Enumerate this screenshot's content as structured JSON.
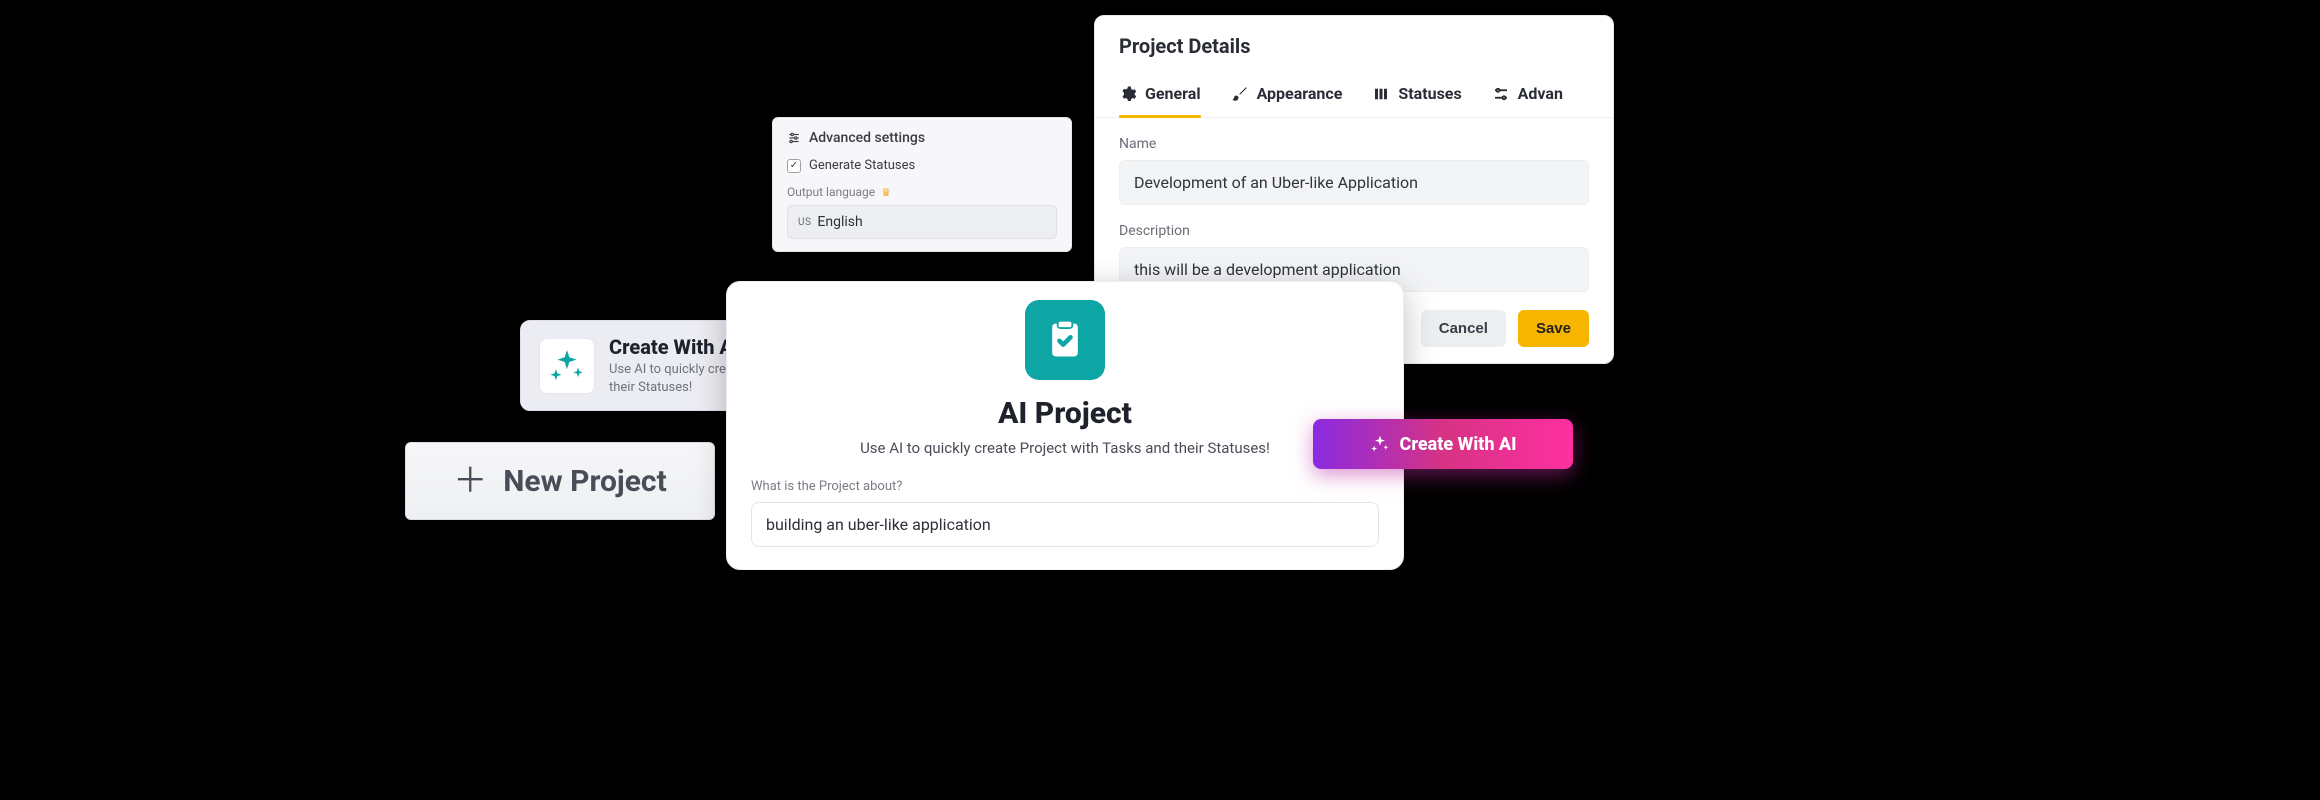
{
  "advanced": {
    "title": "Advanced settings",
    "generate_statuses_label": "Generate Statuses",
    "generate_statuses_checked": true,
    "output_language_label": "Output language",
    "language_prefix": "US",
    "language_value": "English"
  },
  "project_details": {
    "title": "Project Details",
    "tabs": {
      "general": "General",
      "appearance": "Appearance",
      "statuses": "Statuses",
      "advanced": "Advan"
    },
    "name_label": "Name",
    "name_value": "Development of an Uber-like Application",
    "description_label": "Description",
    "description_value": "this will be a development application",
    "cancel_label": "Cancel",
    "save_label": "Save"
  },
  "create_with_ai_card": {
    "title": "Create With AI",
    "subtitle": "Use AI to quickly create Project with Tasks and their Statuses!"
  },
  "new_project": {
    "label": "New Project"
  },
  "ai_modal": {
    "title": "AI Project",
    "subtitle": "Use AI to quickly create Project with Tasks and their Statuses!",
    "prompt_label": "What is the Project about?",
    "prompt_value": "building an uber-like application"
  },
  "cta": {
    "label": "Create With AI"
  },
  "colors": {
    "accent_yellow": "#f5b400",
    "teal": "#0ea5a5",
    "gradient_start": "#8a2be2",
    "gradient_end": "#ff2fa0"
  }
}
